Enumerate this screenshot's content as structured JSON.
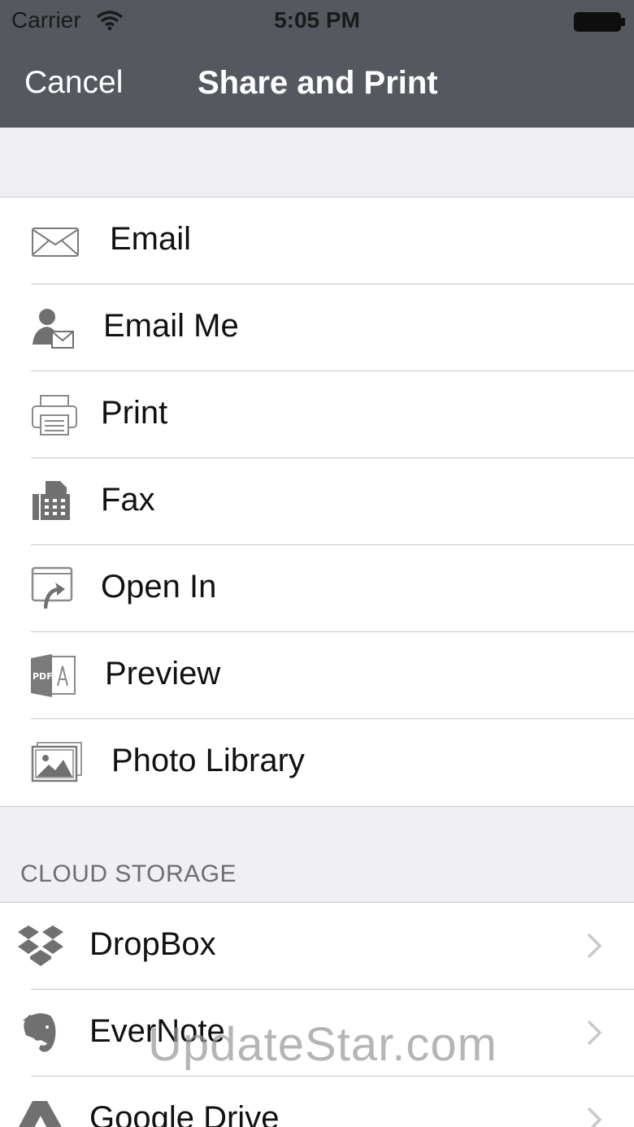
{
  "status_bar": {
    "carrier": "Carrier",
    "time": "5:05 PM"
  },
  "nav": {
    "cancel": "Cancel",
    "title": "Share and Print"
  },
  "share_items": [
    {
      "label": "Email",
      "icon": "envelope-icon"
    },
    {
      "label": "Email Me",
      "icon": "person-envelope-icon"
    },
    {
      "label": "Print",
      "icon": "printer-icon"
    },
    {
      "label": "Fax",
      "icon": "fax-icon"
    },
    {
      "label": "Open In",
      "icon": "open-in-icon"
    },
    {
      "label": "Preview",
      "icon": "pdf-preview-icon"
    },
    {
      "label": "Photo Library",
      "icon": "photo-library-icon"
    }
  ],
  "cloud_storage": {
    "header": "CLOUD STORAGE",
    "items": [
      {
        "label": "DropBox",
        "icon": "dropbox-icon"
      },
      {
        "label": "EverNote",
        "icon": "evernote-icon"
      },
      {
        "label": "Google Drive",
        "icon": "google-drive-icon"
      }
    ]
  },
  "watermark": "UpdateStar.com",
  "colors": {
    "nav_bar": "#55585f",
    "background": "#efeff4",
    "separator": "#c8c7cc",
    "section_header_text": "#6d6d72",
    "icon_gray": "#707070"
  }
}
